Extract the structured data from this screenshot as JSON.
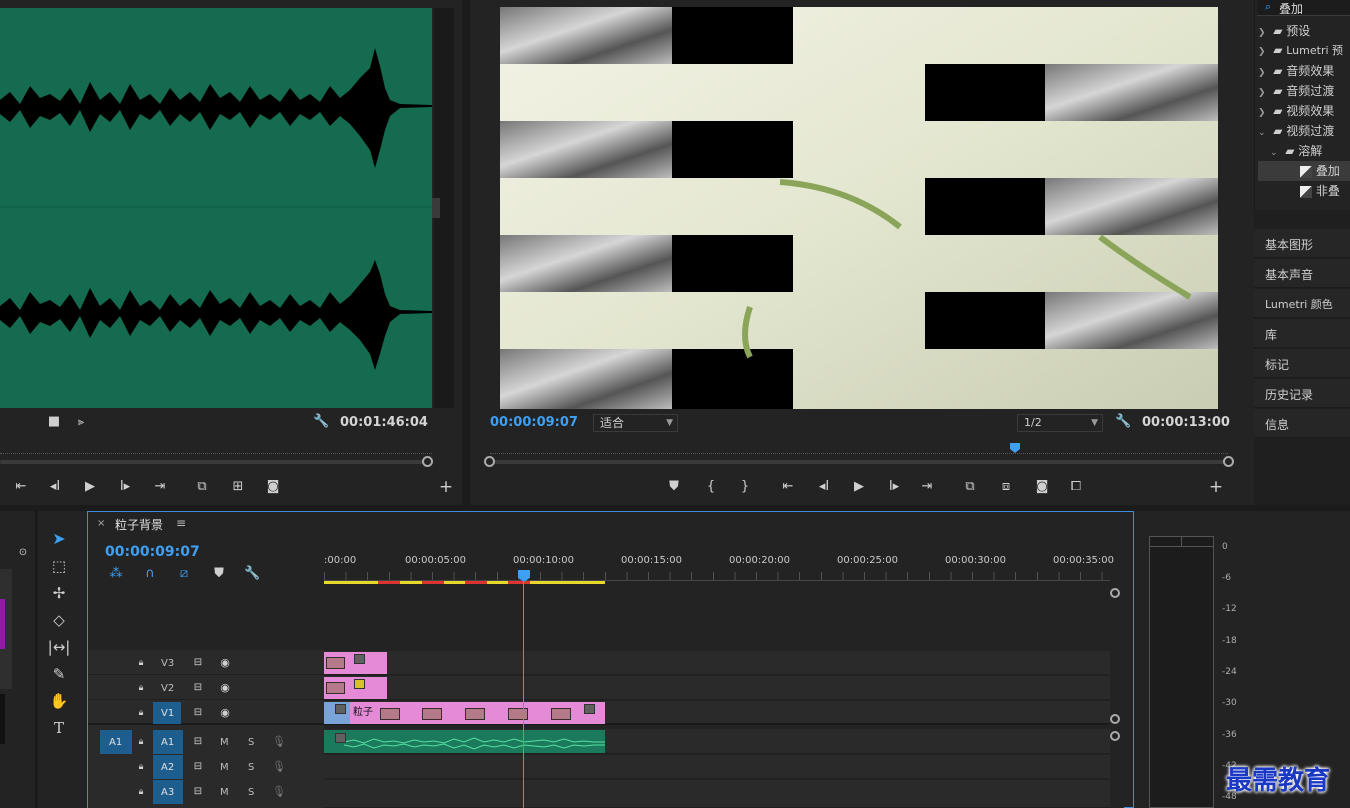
{
  "source_monitor": {
    "timecode": "00:01:46:04",
    "icons": [
      "drag-video-icon",
      "drag-audio-icon",
      "wrench-icon"
    ],
    "transport_icons": [
      "mark-in-icon",
      "step-back-icon",
      "play-icon",
      "step-forward-icon",
      "go-to-out-icon",
      "insert-icon",
      "overwrite-icon",
      "export-frame-icon",
      "add-button-icon"
    ]
  },
  "program_monitor": {
    "timecode_current": "00:00:09:07",
    "fit_label": "适合",
    "resolution_label": "1/2",
    "timecode_duration": "00:00:13:00",
    "transport_icons": [
      "add-marker-icon",
      "mark-in-icon",
      "mark-out-icon",
      "go-to-in-icon",
      "step-back-icon",
      "play-icon",
      "step-forward-icon",
      "go-to-out-icon",
      "lift-icon",
      "extract-icon",
      "export-frame-icon",
      "comparison-view-icon",
      "add-button-icon"
    ]
  },
  "effects_panel": {
    "search_value": "叠加",
    "tree": [
      {
        "label": "预设",
        "type": "folder"
      },
      {
        "label": "Lumetri 预",
        "type": "folder"
      },
      {
        "label": "音频效果",
        "type": "folder"
      },
      {
        "label": "音频过渡",
        "type": "folder"
      },
      {
        "label": "视频效果",
        "type": "folder"
      },
      {
        "label": "视频过渡",
        "type": "folder-open"
      },
      {
        "label": "溶解",
        "type": "subfolder"
      },
      {
        "label": "叠加",
        "type": "effect-selected"
      },
      {
        "label": "非叠",
        "type": "effect"
      }
    ]
  },
  "side_panels": [
    "基本图形",
    "基本声音",
    "Lumetri 颜色",
    "库",
    "标记",
    "历史记录",
    "信息"
  ],
  "timeline": {
    "tab_title": "粒子背景",
    "timecode": "00:00:09:07",
    "ruler_labels": [
      ":00:00",
      "00:00:05:00",
      "00:00:10:00",
      "00:00:15:00",
      "00:00:20:00",
      "00:00:25:00",
      "00:00:30:00",
      "00:00:35:00"
    ],
    "tracks_video": [
      "V3",
      "V2",
      "V1"
    ],
    "tracks_audio": [
      "A1",
      "A2",
      "A3"
    ],
    "source_patch": "A1",
    "audio_buttons": {
      "mute": "M",
      "solo": "S"
    },
    "clip_v1_label": "粒子"
  },
  "audio_meter": {
    "labels": [
      "0",
      "-6",
      "-12",
      "-18",
      "-24",
      "-30",
      "-36",
      "-42",
      "-48"
    ]
  },
  "watermark": "最需教育",
  "colors": {
    "accent_blue": "#3da0f5",
    "waveform_bg": "#146b4f",
    "clip_pink": "#e48ad6",
    "clip_audio": "#1c7a5c",
    "track_blue": "#1d5e8f"
  }
}
